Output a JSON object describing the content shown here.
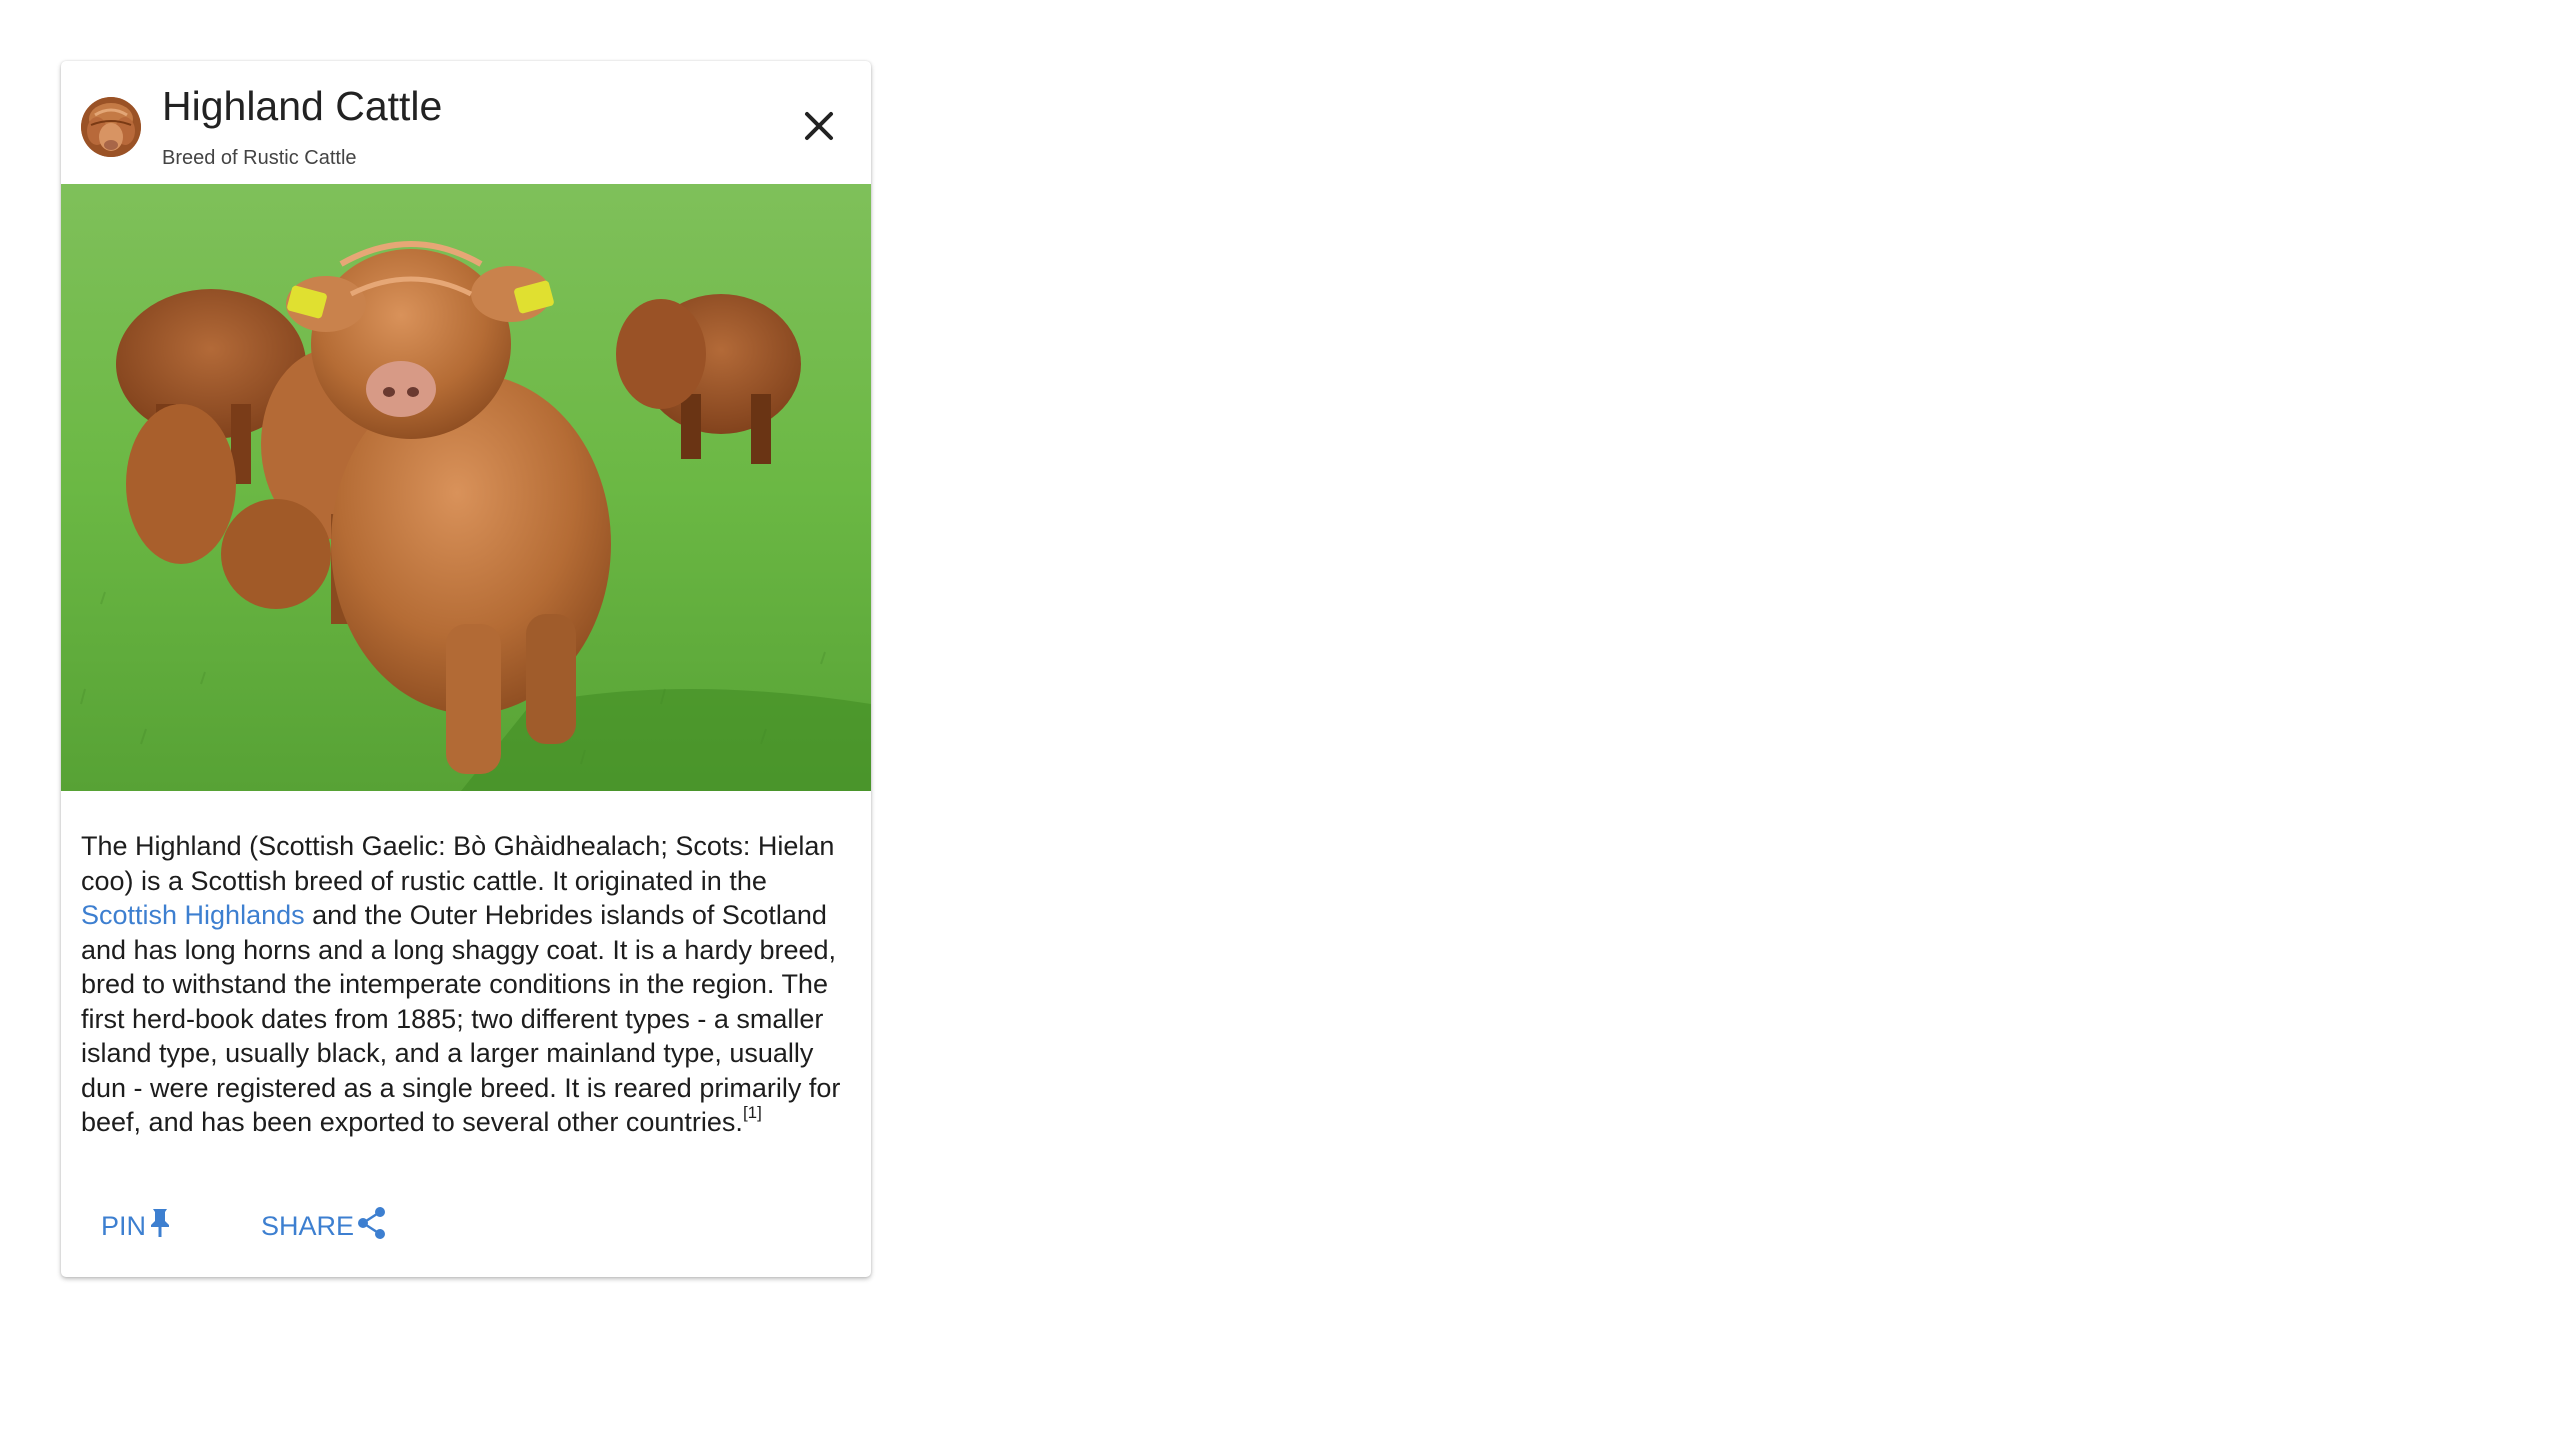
{
  "card": {
    "title": "Highland Cattle",
    "subtitle": "Breed of Rustic Cattle",
    "close_icon": "close-icon",
    "avatar_icon": "highland-cow-avatar",
    "image_description_icon": "highland-calves-photo",
    "body": {
      "before_link": "The Highland (Scottish Gaelic: Bò Ghàidhealach; Scots: Hielan coo) is a Scottish breed of rustic cattle. It originated in the ",
      "link_text": "Scottish Highlands",
      "after_link": " and the Outer Hebrides islands of Scotland and has long horns and a long shaggy coat. It is a hardy breed, bred to withstand the intemperate conditions in the region. The first herd-book dates from 1885; two different types - a smaller island type, usually black, and a larger mainland type, usually dun - were registered as a single breed. It is reared primarily for beef, and has been exported to several other countries.",
      "footnote": "[1]"
    },
    "actions": {
      "pin_label": "PIN",
      "pin_icon": "pin-icon",
      "share_label": "SHARE",
      "share_icon": "share-icon"
    },
    "colors": {
      "accent": "#3d7fd0",
      "text": "#1d1d1d",
      "background": "#ffffff"
    }
  }
}
